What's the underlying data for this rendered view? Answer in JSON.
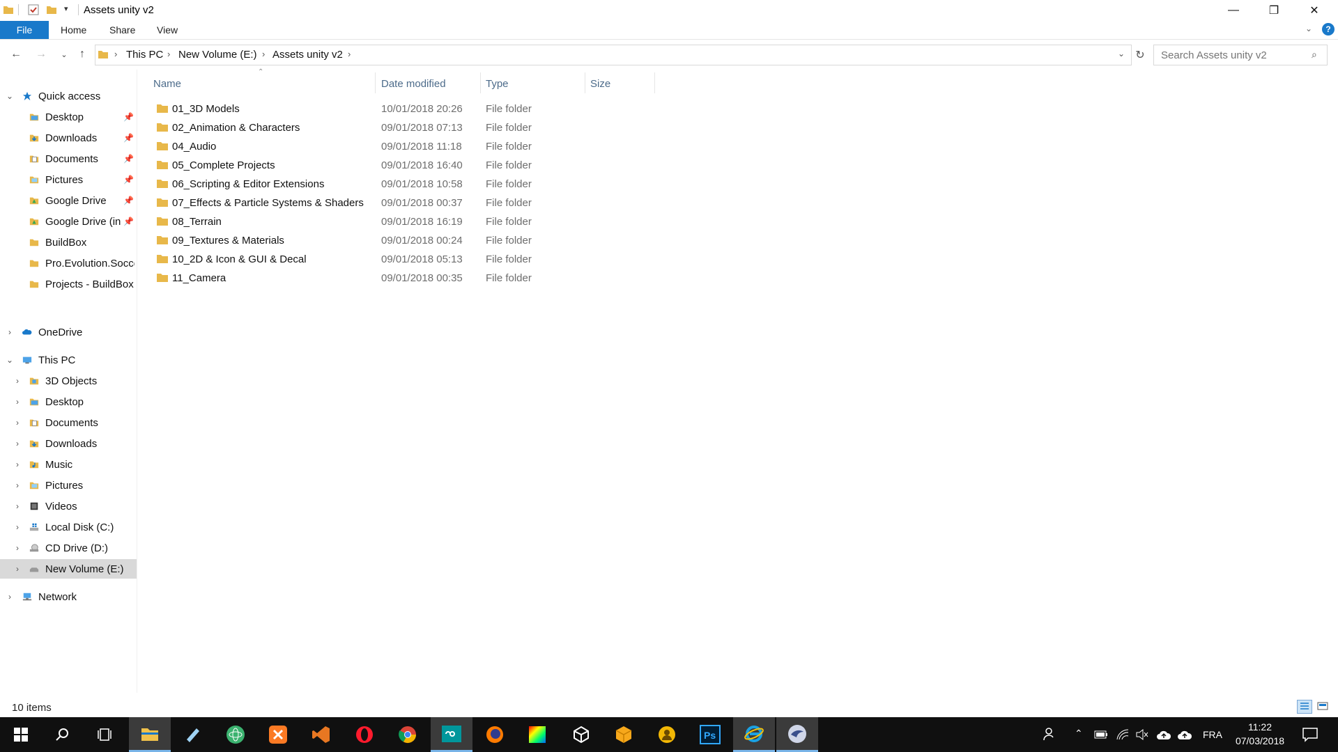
{
  "window": {
    "title": "Assets unity v2",
    "minimize": "—",
    "restore": "❐",
    "close": "✕"
  },
  "ribbon": {
    "tabs": [
      "File",
      "Home",
      "Share",
      "View"
    ]
  },
  "address": {
    "crumbs": [
      "This PC",
      "New Volume (E:)",
      "Assets unity v2"
    ],
    "search_placeholder": "Search Assets unity v2"
  },
  "columns": [
    "Name",
    "Date modified",
    "Type",
    "Size"
  ],
  "files": [
    {
      "name": "01_3D Models",
      "date": "10/01/2018 20:26",
      "type": "File folder"
    },
    {
      "name": "02_Animation & Characters",
      "date": "09/01/2018 07:13",
      "type": "File folder"
    },
    {
      "name": "04_Audio",
      "date": "09/01/2018 11:18",
      "type": "File folder"
    },
    {
      "name": "05_Complete Projects",
      "date": "09/01/2018 16:40",
      "type": "File folder"
    },
    {
      "name": "06_Scripting & Editor Extensions",
      "date": "09/01/2018 10:58",
      "type": "File folder"
    },
    {
      "name": "07_Effects & Particle Systems & Shaders",
      "date": "09/01/2018 00:37",
      "type": "File folder"
    },
    {
      "name": "08_Terrain",
      "date": "09/01/2018 16:19",
      "type": "File folder"
    },
    {
      "name": "09_Textures & Materials",
      "date": "09/01/2018 00:24",
      "type": "File folder"
    },
    {
      "name": "10_2D & Icon & GUI & Decal",
      "date": "09/01/2018 05:13",
      "type": "File folder"
    },
    {
      "name": "11_Camera",
      "date": "09/01/2018 00:35",
      "type": "File folder"
    }
  ],
  "nav": {
    "quick_access": "Quick access",
    "quick_items": [
      "Desktop",
      "Downloads",
      "Documents",
      "Pictures",
      "Google Drive",
      "Google Drive (in",
      "BuildBox",
      "Pro.Evolution.Socce",
      "Projects - BuildBox"
    ],
    "onedrive": "OneDrive",
    "this_pc": "This PC",
    "pc_items": [
      "3D Objects",
      "Desktop",
      "Documents",
      "Downloads",
      "Music",
      "Pictures",
      "Videos",
      "Local Disk (C:)",
      "CD Drive (D:)",
      "New Volume (E:)"
    ],
    "network": "Network"
  },
  "status": {
    "item_count": "10 items"
  },
  "taskbar": {
    "language": "FRA",
    "time": "11:22",
    "date": "07/03/2018"
  },
  "colors": {
    "accent": "#1979ca",
    "folder": "#e8b84a",
    "selected_nav": "#d9d9d9",
    "taskbar": "#101010"
  }
}
